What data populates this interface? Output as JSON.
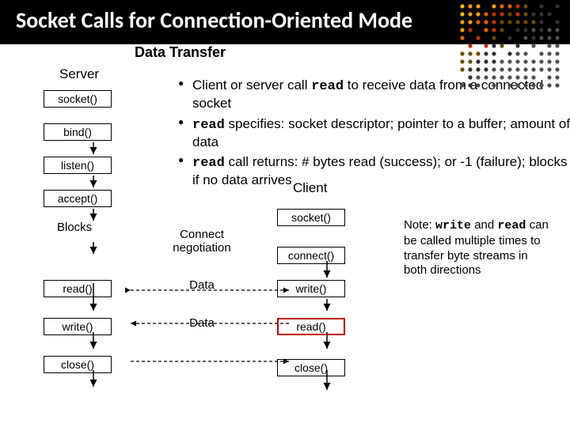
{
  "title": "Socket Calls for Connection-Oriented Mode",
  "section": "Data Transfer",
  "bullets": [
    {
      "pre": "Client or server call ",
      "kw": "read",
      "post": " to receive data from a connected socket"
    },
    {
      "pre": "",
      "kw": "read",
      "post": " specifies: socket descriptor; pointer to a buffer; amount of data"
    },
    {
      "pre": "",
      "kw": "read",
      "post": " call returns: # bytes read (success); or -1 (failure); blocks if no data arrives"
    }
  ],
  "labels": {
    "server": "Server",
    "client": "Client",
    "blocks": "Blocks",
    "connect_neg": "Connect negotiation",
    "data1": "Data",
    "data2": "Data"
  },
  "server_boxes": [
    "socket()",
    "bind()",
    "listen()",
    "accept()",
    "read()",
    "write()",
    "close()"
  ],
  "client_boxes": [
    "socket()",
    "connect()",
    "write()",
    "read()",
    "close()"
  ],
  "note": {
    "pre": "Note: ",
    "kw1": "write",
    "mid": " and ",
    "kw2": "read",
    "post": " can be called multiple times to transfer byte streams in both directions"
  },
  "colors": {
    "accent": "#ffcc00",
    "readbox_border": "#c00000"
  }
}
